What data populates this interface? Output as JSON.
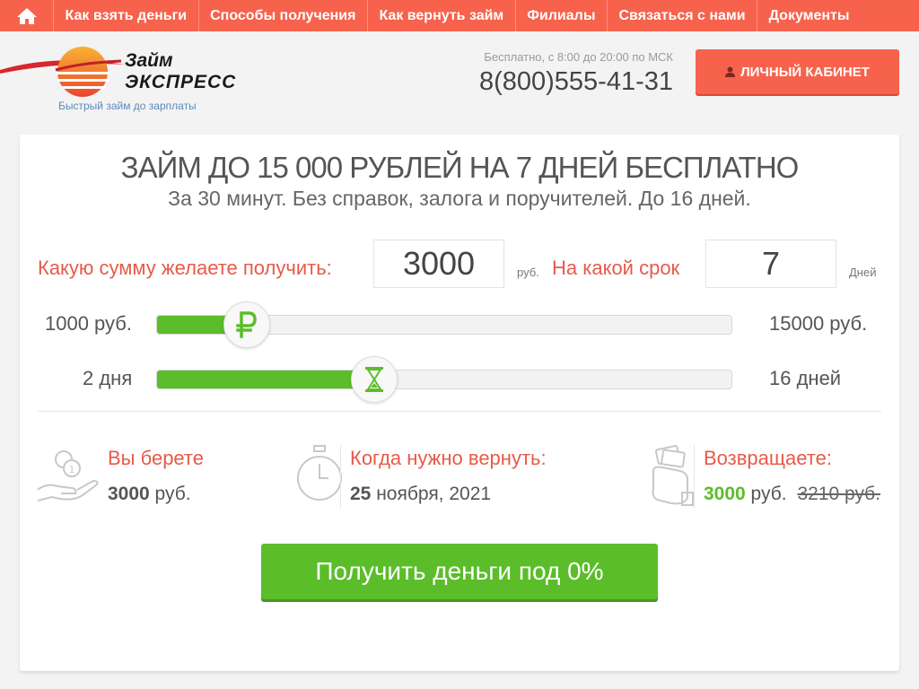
{
  "nav": {
    "items": [
      "Как взять деньги",
      "Способы получения",
      "Как вернуть займ",
      "Филиалы",
      "Связаться с нами",
      "Документы"
    ]
  },
  "logo": {
    "line1": "Займ",
    "line2": "ЭКСПРЕСС",
    "tagline": "Быстрый займ до зарплаты"
  },
  "contact": {
    "hours": "Бесплатно, с 8:00 до 20:00 по МСК",
    "phone": "8(800)555-41-31"
  },
  "cabinet_button": "ЛИЧНЫЙ КАБИНЕТ",
  "calculator": {
    "title": "ЗАЙМ ДО 15 000 РУБЛЕЙ НА 7 ДНЕЙ БЕСПЛАТНО",
    "subtitle": "За 30 минут. Без справок, залога и поручителей. До 16 дней.",
    "amount_label": "Какую сумму желаете получить:",
    "amount_value": "3000",
    "amount_unit": "руб.",
    "term_label": "На какой срок",
    "term_value": "7",
    "term_unit": "Дней",
    "amount_slider": {
      "min_label": "1000 руб.",
      "max_label": "15000 руб.",
      "value_fraction": 0.158
    },
    "term_slider": {
      "min_label": "2 дня",
      "max_label": "16 дней",
      "value_fraction": 0.378
    }
  },
  "summary": {
    "take_label": "Вы берете",
    "take_amount": "3000",
    "take_unit": " руб.",
    "return_date_label": "Когда нужно вернуть:",
    "return_day": "25",
    "return_month_year": " ноября, 2021",
    "repay_label": "Возвращаете:",
    "repay_amount": "3000",
    "repay_unit": " руб.",
    "repay_old": "3210 руб."
  },
  "cta_button": "Получить деньги под 0%",
  "colors": {
    "accent": "#f7624d",
    "green": "#5bbd2a",
    "label_red": "#e75a48"
  }
}
